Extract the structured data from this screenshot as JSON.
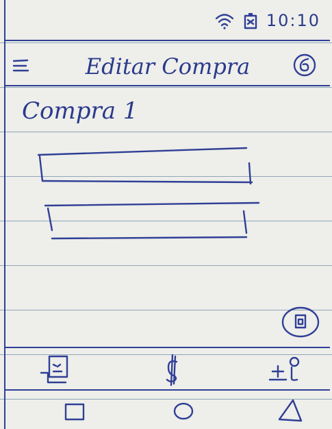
{
  "status_bar": {
    "time": "10:10",
    "icons": [
      "wifi-icon",
      "battery-icon"
    ]
  },
  "app_bar": {
    "title": "Editar Compra",
    "menu_icon": "hamburger-menu-icon",
    "action_icon": "settings-icon"
  },
  "content": {
    "title": "Compra 1",
    "fields": [
      {
        "value": "",
        "placeholder": ""
      },
      {
        "value": "",
        "placeholder": ""
      }
    ]
  },
  "fab": {
    "icon": "document-icon"
  },
  "bottom_nav": {
    "items": [
      {
        "icon": "calendar-icon"
      },
      {
        "icon": "money-icon"
      },
      {
        "icon": "plus-minus-icon"
      }
    ]
  },
  "system_nav": {
    "buttons": [
      {
        "icon": "square-icon"
      },
      {
        "icon": "circle-icon"
      },
      {
        "icon": "triangle-icon"
      }
    ]
  },
  "colors": {
    "ink": "#2f3f96",
    "paper": "#eeeeea",
    "rule": "#8fa6b8"
  }
}
